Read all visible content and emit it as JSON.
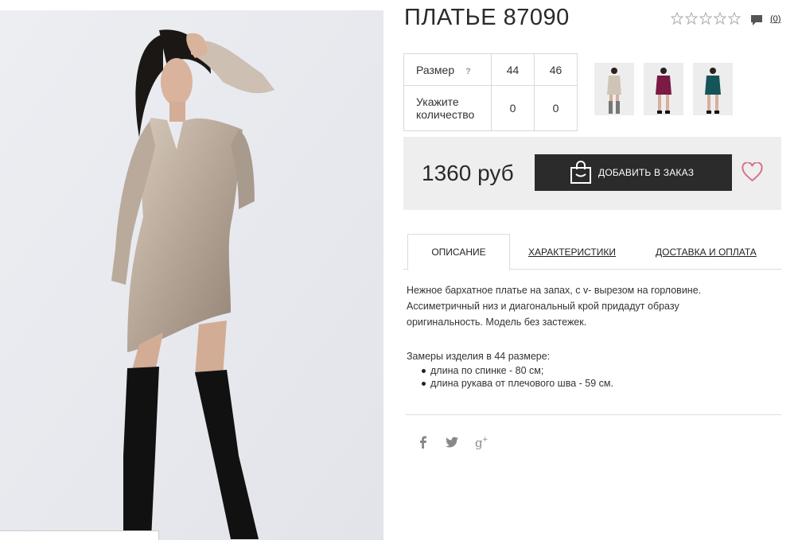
{
  "product": {
    "title": "ПЛАТЬЕ 87090",
    "rating_stars": 0,
    "comment_count": "(0)"
  },
  "sizes": {
    "size_label": "Размер",
    "help": "?",
    "values": [
      "44",
      "46"
    ],
    "qty_label_1": "Укажите",
    "qty_label_2": "количество",
    "quantities": [
      "0",
      "0"
    ]
  },
  "thumbnails": [
    {
      "name": "thumb-beige",
      "color": "#cfc4b8"
    },
    {
      "name": "thumb-burgundy",
      "color": "#7a1a45"
    },
    {
      "name": "thumb-teal",
      "color": "#15555a"
    }
  ],
  "purchase": {
    "price": "1360 руб",
    "order_button": "ДОБАВИТЬ В ЗАКАЗ",
    "wishlist_icon": "heart-icon"
  },
  "tabs": [
    {
      "label": "ОПИСАНИЕ",
      "active": true
    },
    {
      "label": "ХАРАКТЕРИСТИКИ",
      "active": false
    },
    {
      "label": "ДОСТАВКА И ОПЛАТА",
      "active": false
    }
  ],
  "description": {
    "line1": "Нежное бархатное платье на запах, с v- вырезом на горловине.",
    "line2": "Ассиметричный низ и диагональный крой придадут образу",
    "line3": "оригинальность. Модель без застежек.",
    "measure_title": "Замеры изделия в 44 размере:",
    "measures": [
      "длина по спинке - 80 см;",
      "длина рукава от плечового шва - 59 см."
    ]
  },
  "social": [
    "facebook-icon",
    "twitter-icon",
    "google-plus-icon"
  ],
  "colors": {
    "button_bg": "#2b2b2b",
    "price_box_bg": "#eeeeee",
    "heart": "#d9708a"
  }
}
